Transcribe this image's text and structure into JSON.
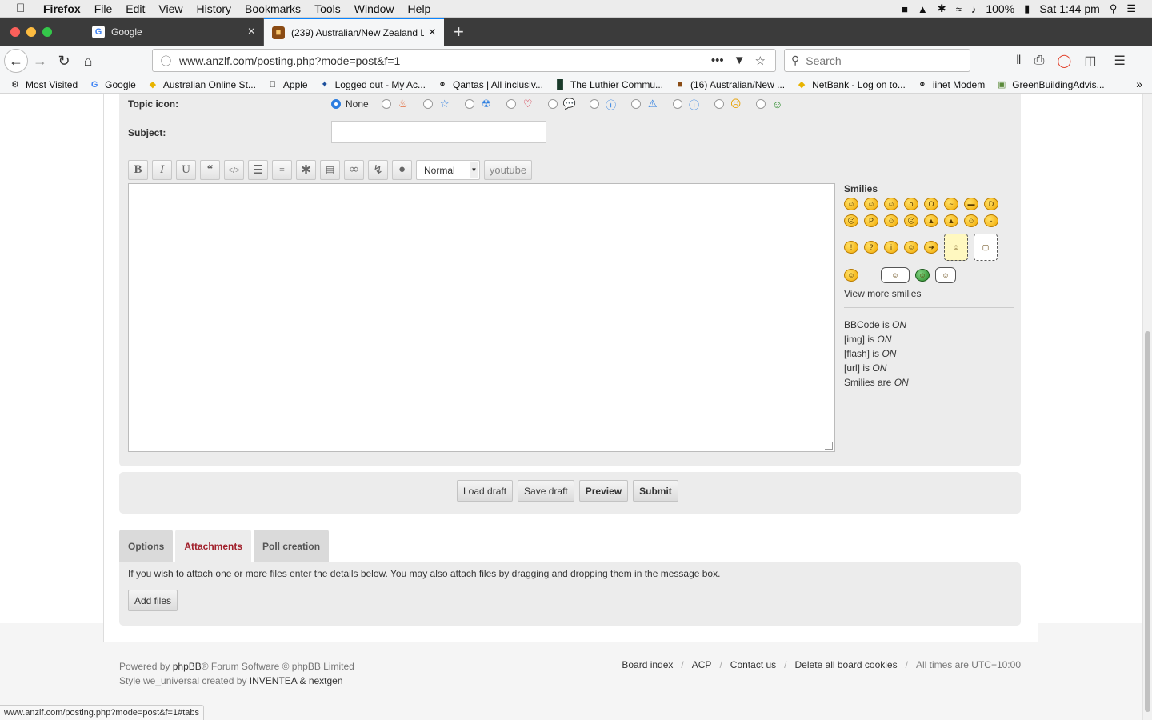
{
  "menubar": {
    "app": "Firefox",
    "items": [
      "File",
      "Edit",
      "View",
      "History",
      "Bookmarks",
      "Tools",
      "Window",
      "Help"
    ],
    "battery": "100%",
    "clock": "Sat 1:44 pm"
  },
  "tabs": [
    {
      "title": "Google",
      "favicon": "G"
    },
    {
      "title": "(239) Australian/New Zealand L",
      "favicon": "■"
    }
  ],
  "nav": {
    "url": "www.anzlf.com/posting.php?mode=post&f=1",
    "search_placeholder": "Search"
  },
  "bookmarks": [
    {
      "label": "Most Visited",
      "icon": "gear-icon"
    },
    {
      "label": "Google",
      "icon": "google-icon"
    },
    {
      "label": "Australian Online St...",
      "icon": "tag-icon"
    },
    {
      "label": "Apple",
      "icon": "apple-icon"
    },
    {
      "label": "Logged out - My Ac...",
      "icon": "bookmark-icon"
    },
    {
      "label": "Qantas | All inclusiv...",
      "icon": "globe-icon"
    },
    {
      "label": "The Luthier Commu...",
      "icon": "book-icon"
    },
    {
      "label": "(16) Australian/New ...",
      "icon": "forum-icon"
    },
    {
      "label": "NetBank - Log on to...",
      "icon": "tag-icon"
    },
    {
      "label": "iinet Modem",
      "icon": "globe-icon"
    },
    {
      "label": "GreenBuildingAdvis...",
      "icon": "building-icon"
    }
  ],
  "form": {
    "topic_icon_label": "Topic icon:",
    "topic_icon_none": "None",
    "subject_label": "Subject:",
    "font_size_select": "Normal",
    "youtube_label": "youtube",
    "smilies_title": "Smilies",
    "view_more_smilies": "View more smilies",
    "status": {
      "bbcode": "BBCode is",
      "img": "[img] is",
      "flash": "[flash] is",
      "url": "[url] is",
      "smilies": "Smilies are",
      "on": "ON"
    }
  },
  "buttons": {
    "load_draft": "Load draft",
    "save_draft": "Save draft",
    "preview": "Preview",
    "submit": "Submit",
    "add_files": "Add files"
  },
  "panel_tabs": [
    "Options",
    "Attachments",
    "Poll creation"
  ],
  "attachments_text": "If you wish to attach one or more files enter the details below. You may also attach files by dragging and dropping them in the message box.",
  "footer": {
    "powered_by": "Powered by",
    "phpbb": "phpBB",
    "forum_software": "® Forum Software © phpBB Limited",
    "style_prefix": "Style we_universal created by",
    "inventea": "INVENTEA",
    "amp": "&",
    "nextgen": "nextgen",
    "links": [
      "Board index",
      "ACP",
      "Contact us",
      "Delete all board cookies"
    ],
    "timezone": "All times are UTC+10:00"
  },
  "statusbar_url": "www.anzlf.com/posting.php?mode=post&f=1#tabs",
  "colors": {
    "active_tab_accent": "#a1212c",
    "panel_bg": "#ececec",
    "radio_selected": "#2b7de0"
  }
}
